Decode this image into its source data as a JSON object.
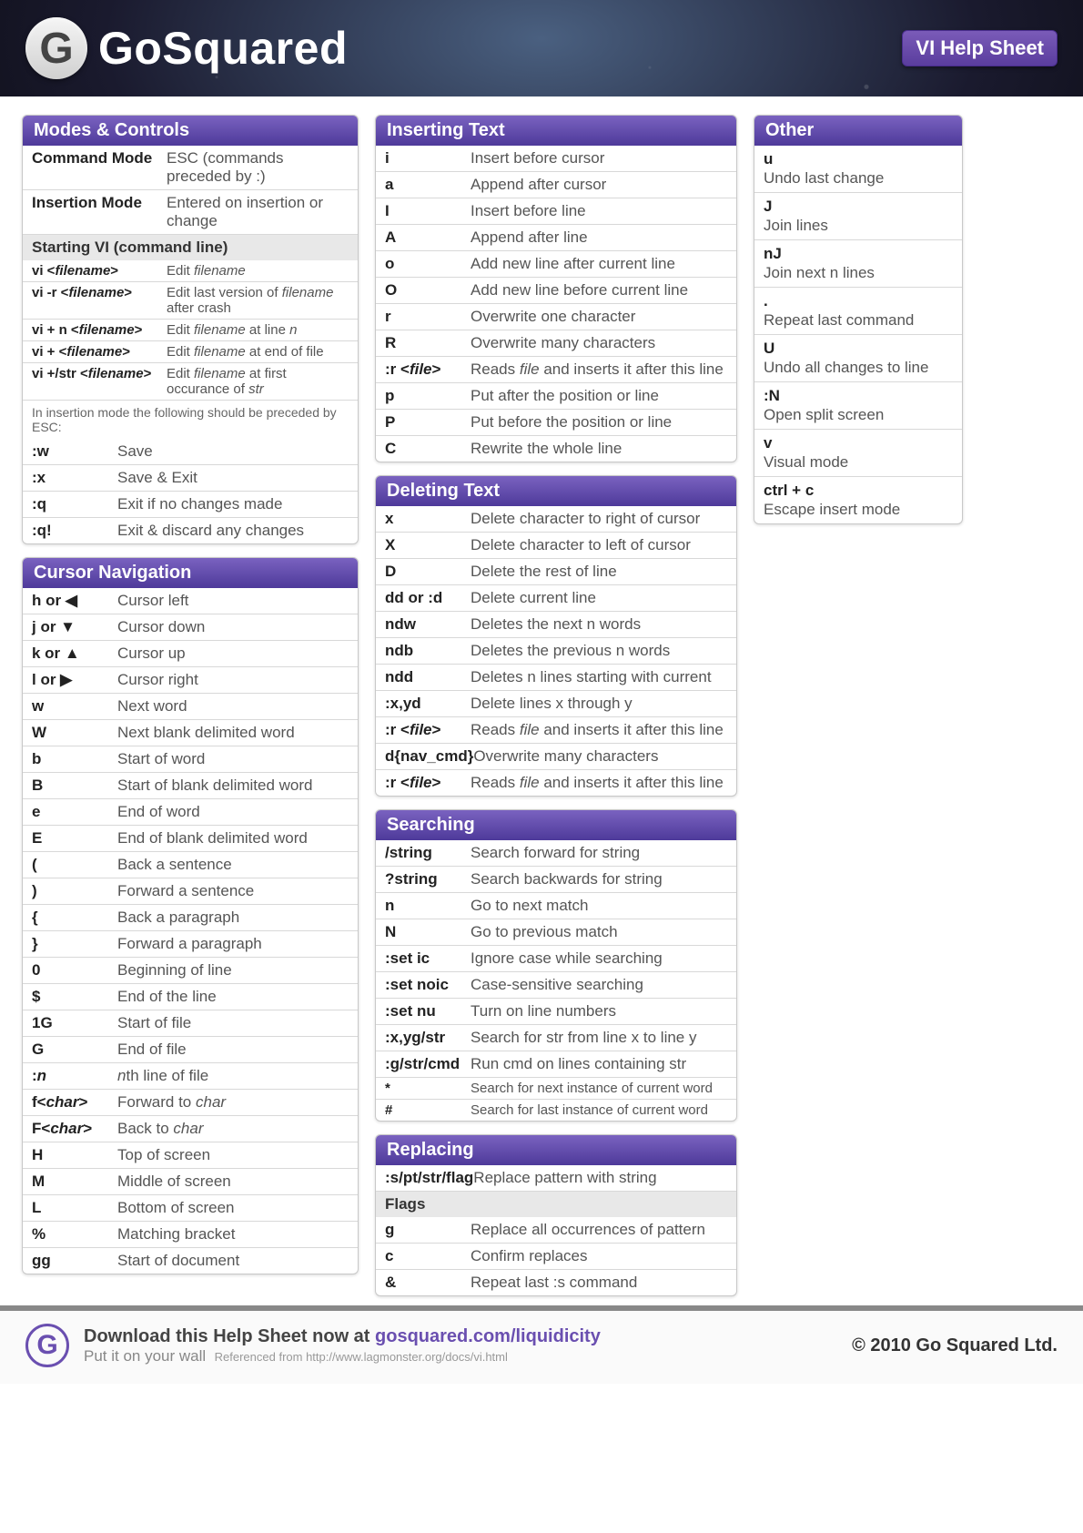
{
  "header": {
    "brand": "GoSquared",
    "badge": "VI Help Sheet"
  },
  "footer": {
    "l1a": "Download this Help Sheet now at ",
    "l1b": "gosquared.com/liquidicity",
    "l2": "Put it on your wall",
    "ref": "Referenced from http://www.lagmonster.org/docs/vi.html",
    "copy": "© 2010 Go Squared Ltd."
  },
  "sections": {
    "modes": {
      "title": "Modes & Controls",
      "top": [
        {
          "k": "Command Mode",
          "v": "ESC (commands preceded by :)",
          "klass": "big"
        },
        {
          "k": "Insertion Mode",
          "v": "Entered on insertion or change",
          "klass": "big"
        }
      ],
      "sub": "Starting VI (command line)",
      "start": [
        {
          "k": "vi <filename>",
          "v": "Edit <i>filename</i>"
        },
        {
          "k": "vi -r <filename>",
          "v": "Edit last version of <i>filename</i> after crash"
        },
        {
          "k": "vi + n <filename>",
          "v": "Edit <i>filename</i> at line <i>n</i>"
        },
        {
          "k": "vi + <filename>",
          "v": "Edit <i>filename</i> at end of file"
        },
        {
          "k": "vi +/str <filename>",
          "v": "Edit <i>filename</i> at first occurance of <i>str</i>"
        }
      ],
      "note": "In insertion mode the following should be preceded by ESC:",
      "cmds": [
        {
          "k": ":w",
          "v": "Save"
        },
        {
          "k": ":x",
          "v": "Save & Exit"
        },
        {
          "k": ":q",
          "v": "Exit if no changes made"
        },
        {
          "k": ":q!",
          "v": "Exit & discard any changes"
        }
      ]
    },
    "cursor": {
      "title": "Cursor Navigation",
      "rows": [
        {
          "k": "h or ◀",
          "v": "Cursor left"
        },
        {
          "k": "j or ▼",
          "v": "Cursor down"
        },
        {
          "k": "k or ▲",
          "v": "Cursor up"
        },
        {
          "k": "l or ▶",
          "v": "Cursor right"
        },
        {
          "k": "w",
          "v": "Next word"
        },
        {
          "k": "W",
          "v": "Next blank delimited word"
        },
        {
          "k": "b",
          "v": "Start of word"
        },
        {
          "k": "B",
          "v": "Start of blank delimited word"
        },
        {
          "k": "e",
          "v": "End of word"
        },
        {
          "k": "E",
          "v": "End of blank delimited word"
        },
        {
          "k": "(",
          "v": "Back a sentence"
        },
        {
          "k": ")",
          "v": "Forward a sentence"
        },
        {
          "k": "{",
          "v": "Back a paragraph"
        },
        {
          "k": "}",
          "v": "Forward a paragraph"
        },
        {
          "k": "0",
          "v": "Beginning of line"
        },
        {
          "k": "$",
          "v": "End of the line"
        },
        {
          "k": "1G",
          "v": "Start of file"
        },
        {
          "k": "G",
          "v": "End of file"
        },
        {
          "k": ":<i>n</i>",
          "v": "<i>n</i>th line of file"
        },
        {
          "k": "f<<i>char</i>>",
          "v": "Forward to <i>char</i>"
        },
        {
          "k": "F<<i>char</i>>",
          "v": "Back to <i>char</i>"
        },
        {
          "k": "H",
          "v": "Top of screen"
        },
        {
          "k": "M",
          "v": "Middle of screen"
        },
        {
          "k": "L",
          "v": "Bottom of screen"
        },
        {
          "k": "%",
          "v": "Matching bracket"
        },
        {
          "k": "gg",
          "v": "Start of document"
        }
      ]
    },
    "insert": {
      "title": "Inserting Text",
      "rows": [
        {
          "k": "i",
          "v": "Insert before cursor"
        },
        {
          "k": "a",
          "v": "Append after cursor"
        },
        {
          "k": "I",
          "v": "Insert before line"
        },
        {
          "k": "A",
          "v": "Append after line"
        },
        {
          "k": "o",
          "v": "Add new line after current line"
        },
        {
          "k": "O",
          "v": "Add new line before current line"
        },
        {
          "k": "r",
          "v": "Overwrite one character"
        },
        {
          "k": "R",
          "v": "Overwrite many characters"
        },
        {
          "k": ":r <<i>file</i>>",
          "v": "Reads <i>file</i> and inserts it after this line"
        },
        {
          "k": "p",
          "v": "Put after the position or line"
        },
        {
          "k": "P",
          "v": "Put before the position or line"
        },
        {
          "k": "C",
          "v": "Rewrite the whole line"
        }
      ]
    },
    "delete": {
      "title": "Deleting Text",
      "rows": [
        {
          "k": "x",
          "v": "Delete character to right of cursor"
        },
        {
          "k": "X",
          "v": "Delete character to left of cursor"
        },
        {
          "k": "D",
          "v": "Delete the rest of line"
        },
        {
          "k": "dd or :d",
          "v": "Delete current line"
        },
        {
          "k": "ndw",
          "v": "Deletes the next n words"
        },
        {
          "k": "ndb",
          "v": "Deletes the previous n words"
        },
        {
          "k": "ndd",
          "v": "Deletes n lines starting with current"
        },
        {
          "k": ":x,yd",
          "v": "Delete lines x through y"
        },
        {
          "k": ":r <<i>file</i>>",
          "v": "Reads <i>file</i> and inserts it after this line"
        },
        {
          "k": "d{nav_cmd}",
          "v": "Overwrite many characters"
        },
        {
          "k": ":r <<i>file</i>>",
          "v": "Reads <i>file</i> and inserts it after this line"
        }
      ]
    },
    "search": {
      "title": "Searching",
      "rows": [
        {
          "k": "/string",
          "v": "Search forward for string"
        },
        {
          "k": "?string",
          "v": "Search backwards for string"
        },
        {
          "k": "n",
          "v": "Go to next match"
        },
        {
          "k": "N",
          "v": "Go to previous match"
        },
        {
          "k": ":set ic",
          "v": "Ignore case while searching"
        },
        {
          "k": ":set noic",
          "v": "Case-sensitive searching"
        },
        {
          "k": ":set nu",
          "v": "Turn on line numbers"
        },
        {
          "k": ":x,yg/str",
          "v": "Search for str from line x to line y"
        },
        {
          "k": ":g/str/cmd",
          "v": "Run cmd on lines containing str"
        },
        {
          "k": "*",
          "v": "Search for next instance of current word",
          "small": true
        },
        {
          "k": "#",
          "v": "Search for last instance of current word",
          "small": true
        }
      ]
    },
    "replace": {
      "title": "Replacing",
      "rows": [
        {
          "k": ":s/pt/str/flag",
          "v": "Replace pattern with string"
        }
      ],
      "sub": "Flags",
      "flags": [
        {
          "k": "g",
          "v": "Replace all occurrences of pattern"
        },
        {
          "k": "c",
          "v": "Confirm replaces"
        },
        {
          "k": "&",
          "v": "Repeat last :s command"
        }
      ]
    },
    "other": {
      "title": "Other",
      "rows": [
        {
          "k": "u",
          "v": "Undo last change"
        },
        {
          "k": "J",
          "v": "Join lines"
        },
        {
          "k": "nJ",
          "v": "Join next n lines"
        },
        {
          "k": ".",
          "v": "Repeat last command"
        },
        {
          "k": "U",
          "v": "Undo all changes to line"
        },
        {
          "k": ":N",
          "v": "Open split screen"
        },
        {
          "k": "v",
          "v": "Visual mode"
        },
        {
          "k": "ctrl + c",
          "v": "Escape insert mode"
        }
      ]
    }
  }
}
